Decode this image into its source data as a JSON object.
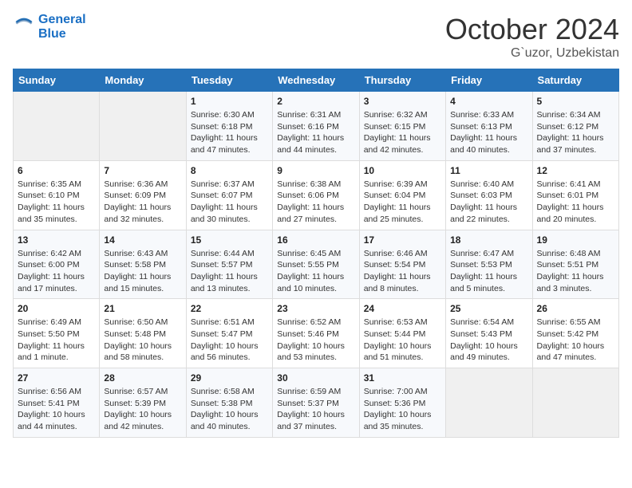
{
  "header": {
    "logo_line1": "General",
    "logo_line2": "Blue",
    "month": "October 2024",
    "location": "G`uzor, Uzbekistan"
  },
  "weekdays": [
    "Sunday",
    "Monday",
    "Tuesday",
    "Wednesday",
    "Thursday",
    "Friday",
    "Saturday"
  ],
  "weeks": [
    [
      {
        "day": "",
        "info": ""
      },
      {
        "day": "",
        "info": ""
      },
      {
        "day": "1",
        "info": "Sunrise: 6:30 AM\nSunset: 6:18 PM\nDaylight: 11 hours and 47 minutes."
      },
      {
        "day": "2",
        "info": "Sunrise: 6:31 AM\nSunset: 6:16 PM\nDaylight: 11 hours and 44 minutes."
      },
      {
        "day": "3",
        "info": "Sunrise: 6:32 AM\nSunset: 6:15 PM\nDaylight: 11 hours and 42 minutes."
      },
      {
        "day": "4",
        "info": "Sunrise: 6:33 AM\nSunset: 6:13 PM\nDaylight: 11 hours and 40 minutes."
      },
      {
        "day": "5",
        "info": "Sunrise: 6:34 AM\nSunset: 6:12 PM\nDaylight: 11 hours and 37 minutes."
      }
    ],
    [
      {
        "day": "6",
        "info": "Sunrise: 6:35 AM\nSunset: 6:10 PM\nDaylight: 11 hours and 35 minutes."
      },
      {
        "day": "7",
        "info": "Sunrise: 6:36 AM\nSunset: 6:09 PM\nDaylight: 11 hours and 32 minutes."
      },
      {
        "day": "8",
        "info": "Sunrise: 6:37 AM\nSunset: 6:07 PM\nDaylight: 11 hours and 30 minutes."
      },
      {
        "day": "9",
        "info": "Sunrise: 6:38 AM\nSunset: 6:06 PM\nDaylight: 11 hours and 27 minutes."
      },
      {
        "day": "10",
        "info": "Sunrise: 6:39 AM\nSunset: 6:04 PM\nDaylight: 11 hours and 25 minutes."
      },
      {
        "day": "11",
        "info": "Sunrise: 6:40 AM\nSunset: 6:03 PM\nDaylight: 11 hours and 22 minutes."
      },
      {
        "day": "12",
        "info": "Sunrise: 6:41 AM\nSunset: 6:01 PM\nDaylight: 11 hours and 20 minutes."
      }
    ],
    [
      {
        "day": "13",
        "info": "Sunrise: 6:42 AM\nSunset: 6:00 PM\nDaylight: 11 hours and 17 minutes."
      },
      {
        "day": "14",
        "info": "Sunrise: 6:43 AM\nSunset: 5:58 PM\nDaylight: 11 hours and 15 minutes."
      },
      {
        "day": "15",
        "info": "Sunrise: 6:44 AM\nSunset: 5:57 PM\nDaylight: 11 hours and 13 minutes."
      },
      {
        "day": "16",
        "info": "Sunrise: 6:45 AM\nSunset: 5:55 PM\nDaylight: 11 hours and 10 minutes."
      },
      {
        "day": "17",
        "info": "Sunrise: 6:46 AM\nSunset: 5:54 PM\nDaylight: 11 hours and 8 minutes."
      },
      {
        "day": "18",
        "info": "Sunrise: 6:47 AM\nSunset: 5:53 PM\nDaylight: 11 hours and 5 minutes."
      },
      {
        "day": "19",
        "info": "Sunrise: 6:48 AM\nSunset: 5:51 PM\nDaylight: 11 hours and 3 minutes."
      }
    ],
    [
      {
        "day": "20",
        "info": "Sunrise: 6:49 AM\nSunset: 5:50 PM\nDaylight: 11 hours and 1 minute."
      },
      {
        "day": "21",
        "info": "Sunrise: 6:50 AM\nSunset: 5:48 PM\nDaylight: 10 hours and 58 minutes."
      },
      {
        "day": "22",
        "info": "Sunrise: 6:51 AM\nSunset: 5:47 PM\nDaylight: 10 hours and 56 minutes."
      },
      {
        "day": "23",
        "info": "Sunrise: 6:52 AM\nSunset: 5:46 PM\nDaylight: 10 hours and 53 minutes."
      },
      {
        "day": "24",
        "info": "Sunrise: 6:53 AM\nSunset: 5:44 PM\nDaylight: 10 hours and 51 minutes."
      },
      {
        "day": "25",
        "info": "Sunrise: 6:54 AM\nSunset: 5:43 PM\nDaylight: 10 hours and 49 minutes."
      },
      {
        "day": "26",
        "info": "Sunrise: 6:55 AM\nSunset: 5:42 PM\nDaylight: 10 hours and 47 minutes."
      }
    ],
    [
      {
        "day": "27",
        "info": "Sunrise: 6:56 AM\nSunset: 5:41 PM\nDaylight: 10 hours and 44 minutes."
      },
      {
        "day": "28",
        "info": "Sunrise: 6:57 AM\nSunset: 5:39 PM\nDaylight: 10 hours and 42 minutes."
      },
      {
        "day": "29",
        "info": "Sunrise: 6:58 AM\nSunset: 5:38 PM\nDaylight: 10 hours and 40 minutes."
      },
      {
        "day": "30",
        "info": "Sunrise: 6:59 AM\nSunset: 5:37 PM\nDaylight: 10 hours and 37 minutes."
      },
      {
        "day": "31",
        "info": "Sunrise: 7:00 AM\nSunset: 5:36 PM\nDaylight: 10 hours and 35 minutes."
      },
      {
        "day": "",
        "info": ""
      },
      {
        "day": "",
        "info": ""
      }
    ]
  ]
}
